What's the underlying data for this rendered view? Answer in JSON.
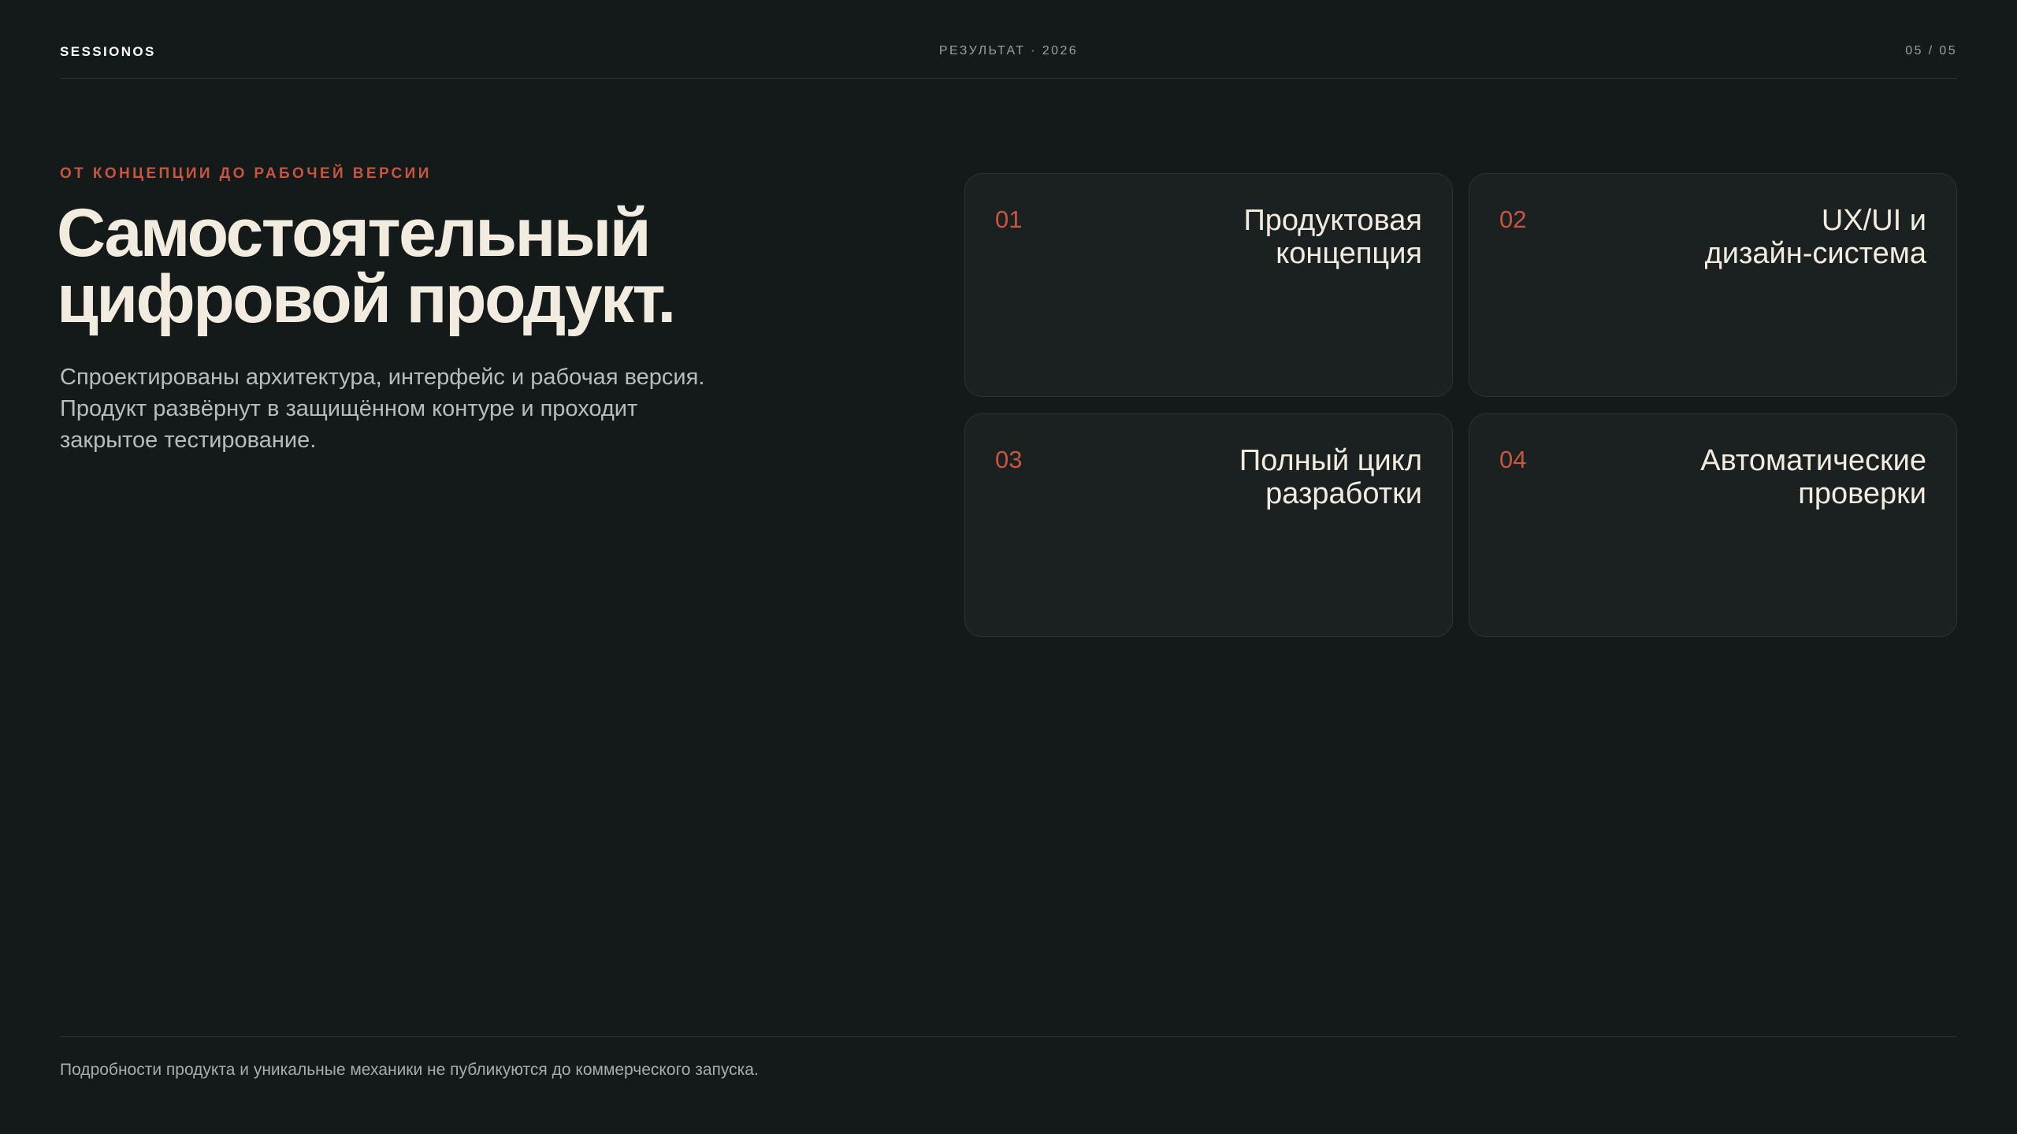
{
  "header": {
    "brand": "SESSIONOS",
    "section": "РЕЗУЛЬТАТ · 2026",
    "page": "05 / 05"
  },
  "hero": {
    "eyebrow": "ОТ КОНЦЕПЦИИ ДО РАБОЧЕЙ ВЕРСИИ",
    "title_lines": [
      "Самостоятельный",
      "цифровой продукт."
    ],
    "description_lines": [
      "Спроектированы архитектура, интерфейс и рабочая версия.",
      "Продукт развёрнут в защищённом контуре и проходит",
      "закрытое тестирование."
    ]
  },
  "cards": [
    {
      "number": "01",
      "title_lines": [
        "Продуктовая",
        "концепция"
      ]
    },
    {
      "number": "02",
      "title_lines": [
        "UX/UI и",
        "дизайн-система"
      ]
    },
    {
      "number": "03",
      "title_lines": [
        "Полный цикл",
        "разработки"
      ]
    },
    {
      "number": "04",
      "title_lines": [
        "Автоматические",
        "проверки"
      ]
    }
  ],
  "footer": {
    "note": "Подробности продукта и уникальные механики не публикуются до коммерческого запуска."
  },
  "colors": {
    "background": "#141919",
    "accent": "#c8553f",
    "card_background": "#1b2121",
    "heading": "#f2ebe0"
  }
}
